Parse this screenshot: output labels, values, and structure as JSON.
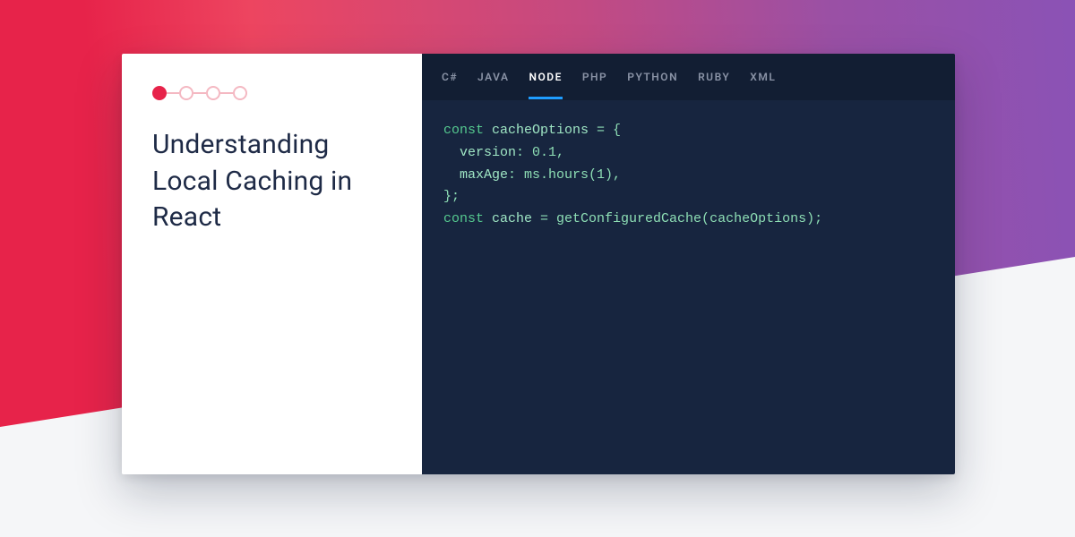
{
  "article": {
    "title": "Understanding Local Caching in React"
  },
  "progress": {
    "steps": 4,
    "current": 1
  },
  "tabs": {
    "items": [
      {
        "label": "C#",
        "active": false
      },
      {
        "label": "JAVA",
        "active": false
      },
      {
        "label": "NODE",
        "active": true
      },
      {
        "label": "PHP",
        "active": false
      },
      {
        "label": "PYTHON",
        "active": false
      },
      {
        "label": "RUBY",
        "active": false
      },
      {
        "label": "XML",
        "active": false
      }
    ]
  },
  "code": {
    "lines": [
      {
        "kw": "const ",
        "id": "cacheOptions",
        "rest": " = {"
      },
      {
        "indent": "  ",
        "id": "version",
        "rest": ": 0.1,"
      },
      {
        "indent": "  ",
        "id": "maxAge",
        "rest": ": ms.hours(1),"
      },
      {
        "rest": "};"
      },
      {
        "kw": "const ",
        "id": "cache",
        "rest": " = getConfiguredCache(cacheOptions);"
      }
    ]
  },
  "colors": {
    "gradient_start": "#e7234a",
    "gradient_end": "#7e53c4",
    "code_bg": "#17253f",
    "tab_bg": "#121e33",
    "tab_active_underline": "#1f9dff",
    "code_text": "#5fd9a5",
    "title_text": "#1e2a46"
  }
}
